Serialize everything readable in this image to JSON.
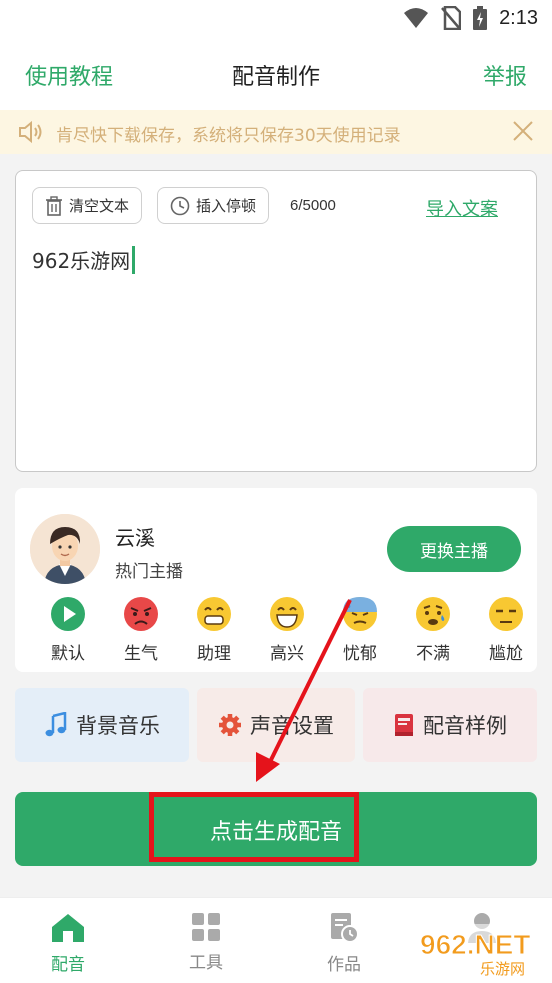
{
  "status_bar": {
    "time": "2:13",
    "icons": [
      "wifi-icon",
      "no-sim-icon",
      "battery-charging-icon"
    ]
  },
  "header": {
    "left_link": "使用教程",
    "title": "配音制作",
    "right_link": "举报"
  },
  "notice": {
    "text": "肯尽快下载保存，系统将只保存30天使用记录"
  },
  "editor": {
    "clear_label": "清空文本",
    "pause_label": "插入停顿",
    "counter": "6/5000",
    "import_label": "导入文案",
    "content": "962乐游网"
  },
  "anchor": {
    "name": "云溪",
    "subtitle": "热门主播",
    "change_label": "更换主播",
    "emotions": [
      {
        "label": "默认",
        "icon": "play-icon"
      },
      {
        "label": "生气",
        "icon": "angry-face-icon"
      },
      {
        "label": "助理",
        "icon": "grin-face-icon"
      },
      {
        "label": "高兴",
        "icon": "happy-face-icon"
      },
      {
        "label": "忧郁",
        "icon": "sad-sweat-face-icon"
      },
      {
        "label": "不满",
        "icon": "worried-face-icon"
      },
      {
        "label": "尴尬",
        "icon": "unamused-face-icon"
      }
    ]
  },
  "features": {
    "music_label": "背景音乐",
    "voice_label": "声音设置",
    "sample_label": "配音样例"
  },
  "generate": {
    "label": "点击生成配音"
  },
  "bottom_nav": {
    "items": [
      {
        "label": "配音",
        "active": true
      },
      {
        "label": "工具",
        "active": false
      },
      {
        "label": "作品",
        "active": false
      },
      {
        "label": "",
        "active": false
      }
    ]
  },
  "watermark": {
    "text": "962.NET",
    "subtext": "乐游网"
  },
  "colors": {
    "accent": "#2fa969",
    "notice_text": "#d4b07a",
    "highlight_red": "#e5131b"
  }
}
